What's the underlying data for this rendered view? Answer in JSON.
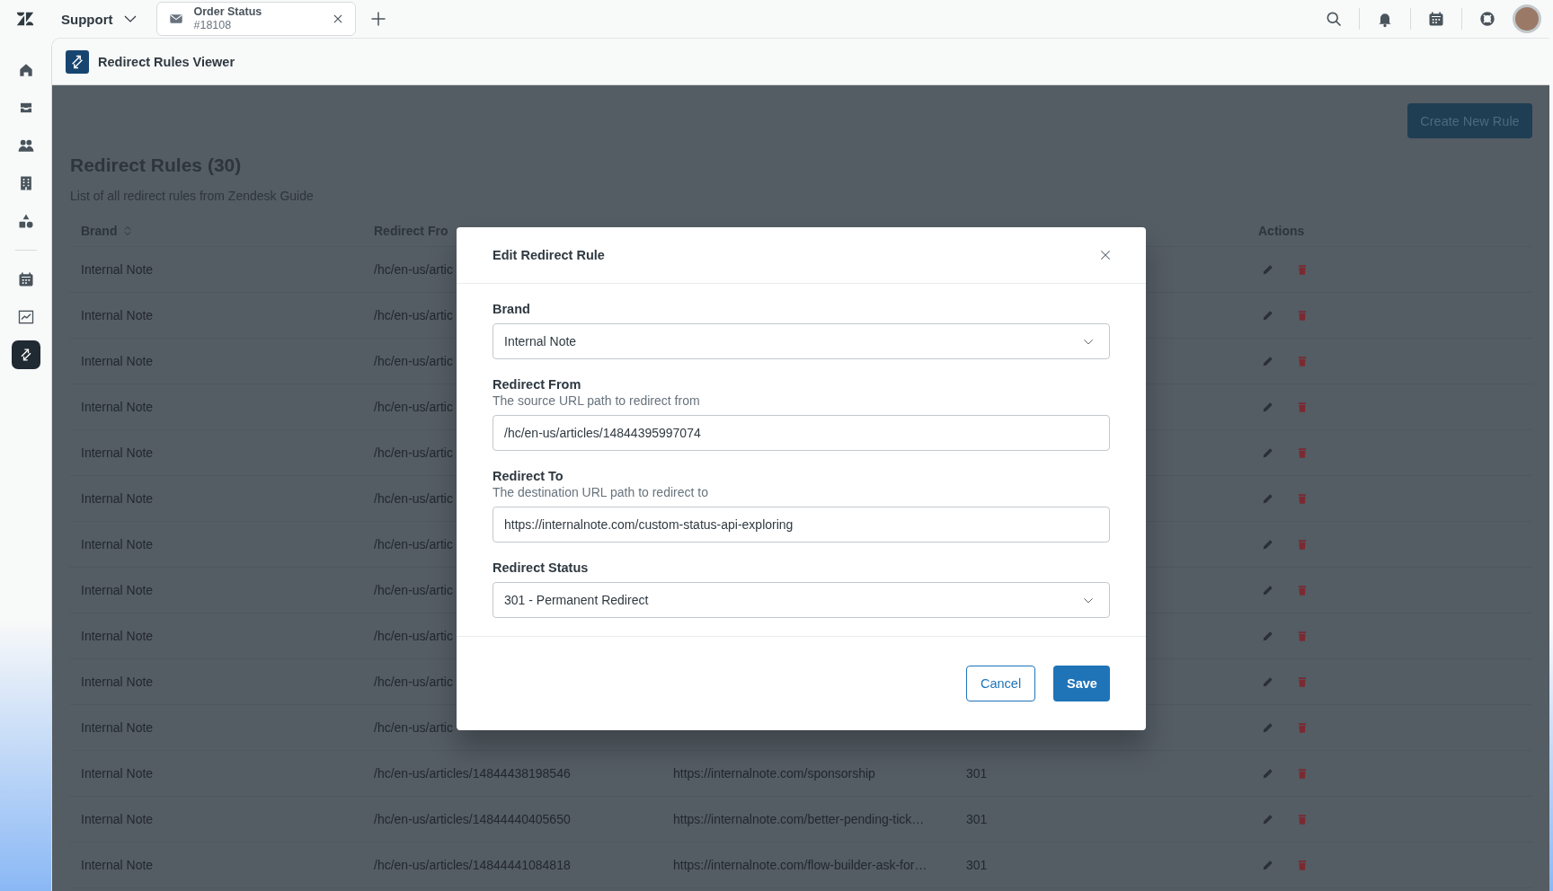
{
  "top_bar": {
    "product": "Support",
    "tabs": [
      {
        "title": "Order Status",
        "subtitle": "#18108",
        "selected": true
      }
    ]
  },
  "sidebar": {
    "items": [
      {
        "kind": "home",
        "selected": false
      },
      {
        "kind": "inbox",
        "selected": false
      },
      {
        "kind": "people",
        "selected": false
      },
      {
        "kind": "building",
        "selected": false
      },
      {
        "kind": "shapes",
        "selected": false
      },
      {
        "kind": "divider"
      },
      {
        "kind": "calendar",
        "selected": false
      },
      {
        "kind": "chart",
        "selected": false
      },
      {
        "kind": "redirect",
        "selected": true
      }
    ]
  },
  "app_header": {
    "title": "Redirect Rules Viewer"
  },
  "page": {
    "create_button": "Create New Rule",
    "title": "Redirect Rules (30)",
    "subtitle": "List of all redirect rules from Zendesk Guide",
    "table": {
      "columns": [
        {
          "label": "Brand",
          "sortable": true
        },
        {
          "label": "Redirect Fro",
          "sortable": false
        },
        {
          "label": "Actions",
          "sortable": false
        }
      ],
      "rows": [
        {
          "brand": "Internal Note",
          "redirect_from": "/hc/en-us/artic"
        },
        {
          "brand": "Internal Note",
          "redirect_from": "/hc/en-us/artic"
        },
        {
          "brand": "Internal Note",
          "redirect_from": "/hc/en-us/artic"
        },
        {
          "brand": "Internal Note",
          "redirect_from": "/hc/en-us/artic"
        },
        {
          "brand": "Internal Note",
          "redirect_from": "/hc/en-us/artic"
        },
        {
          "brand": "Internal Note",
          "redirect_from": "/hc/en-us/artic"
        },
        {
          "brand": "Internal Note",
          "redirect_from": "/hc/en-us/artic"
        },
        {
          "brand": "Internal Note",
          "redirect_from": "/hc/en-us/artic"
        },
        {
          "brand": "Internal Note",
          "redirect_from": "/hc/en-us/artic"
        },
        {
          "brand": "Internal Note",
          "redirect_from": "/hc/en-us/artic"
        },
        {
          "brand": "Internal Note",
          "redirect_from": "/hc/en-us/artic"
        },
        {
          "brand": "Internal Note",
          "redirect_from": "/hc/en-us/articles/14844438198546",
          "redirect_to": "https://internalnote.com/sponsorship",
          "status": "301"
        },
        {
          "brand": "Internal Note",
          "redirect_from": "/hc/en-us/articles/14844440405650",
          "redirect_to": "https://internalnote.com/better-pending-tick…",
          "status": "301"
        },
        {
          "brand": "Internal Note",
          "redirect_from": "/hc/en-us/articles/14844441084818",
          "redirect_to": "https://internalnote.com/flow-builder-ask-for…",
          "status": "301"
        }
      ]
    }
  },
  "modal": {
    "title": "Edit Redirect Rule",
    "fields": [
      {
        "kind": "select",
        "label": "Brand",
        "value": "Internal Note"
      },
      {
        "kind": "input",
        "label": "Redirect From",
        "hint": "The source URL path to redirect from",
        "value": "/hc/en-us/articles/14844395997074"
      },
      {
        "kind": "input",
        "label": "Redirect To",
        "hint": "The destination URL path to redirect to",
        "value": "https://internalnote.com/custom-status-api-exploring"
      },
      {
        "kind": "select",
        "label": "Redirect Status",
        "value": "301 - Permanent Redirect"
      }
    ],
    "buttons": [
      {
        "label": "Cancel",
        "kind": "secondary"
      },
      {
        "label": "Save",
        "kind": "primary"
      }
    ]
  }
}
